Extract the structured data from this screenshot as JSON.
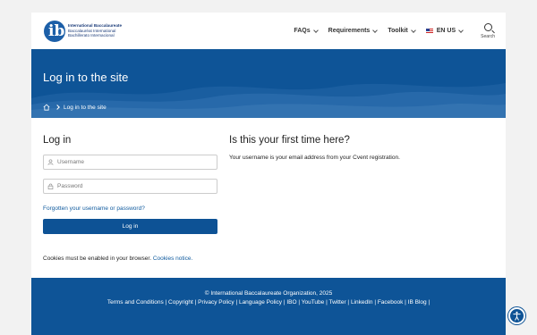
{
  "header": {
    "logo": {
      "line1": "International Baccalaureate",
      "line2": "Baccalauréat International",
      "line3": "Bachillerato Internacional"
    },
    "nav": [
      {
        "label": "FAQs"
      },
      {
        "label": "Requirements"
      },
      {
        "label": "Toolkit"
      },
      {
        "label": "EN US"
      }
    ],
    "search_label": "Search"
  },
  "banner": {
    "title": "Log in to the site",
    "breadcrumb": "Log in to the site"
  },
  "login": {
    "heading": "Log in",
    "username_placeholder": "Username",
    "password_placeholder": "Password",
    "forgot_label": "Forgotten your username or password?",
    "button_label": "Log in",
    "cookies_text": "Cookies must be enabled in your browser.",
    "cookies_link": "Cookies notice."
  },
  "first_time": {
    "heading": "Is this your first time here?",
    "text": "Your username is your email address from your Cvent registration."
  },
  "footer": {
    "copyright": "© International Baccalaureate Organization, 2025",
    "links": [
      "Terms and Conditions",
      "Copyright",
      "Privacy Policy",
      "Language Policy",
      "IBO",
      "YouTube",
      "Twitter",
      "LinkedIn",
      "Facebook",
      "IB Blog"
    ]
  },
  "colors": {
    "brand_blue": "#0e5497",
    "link_blue": "#0f5a9e"
  }
}
